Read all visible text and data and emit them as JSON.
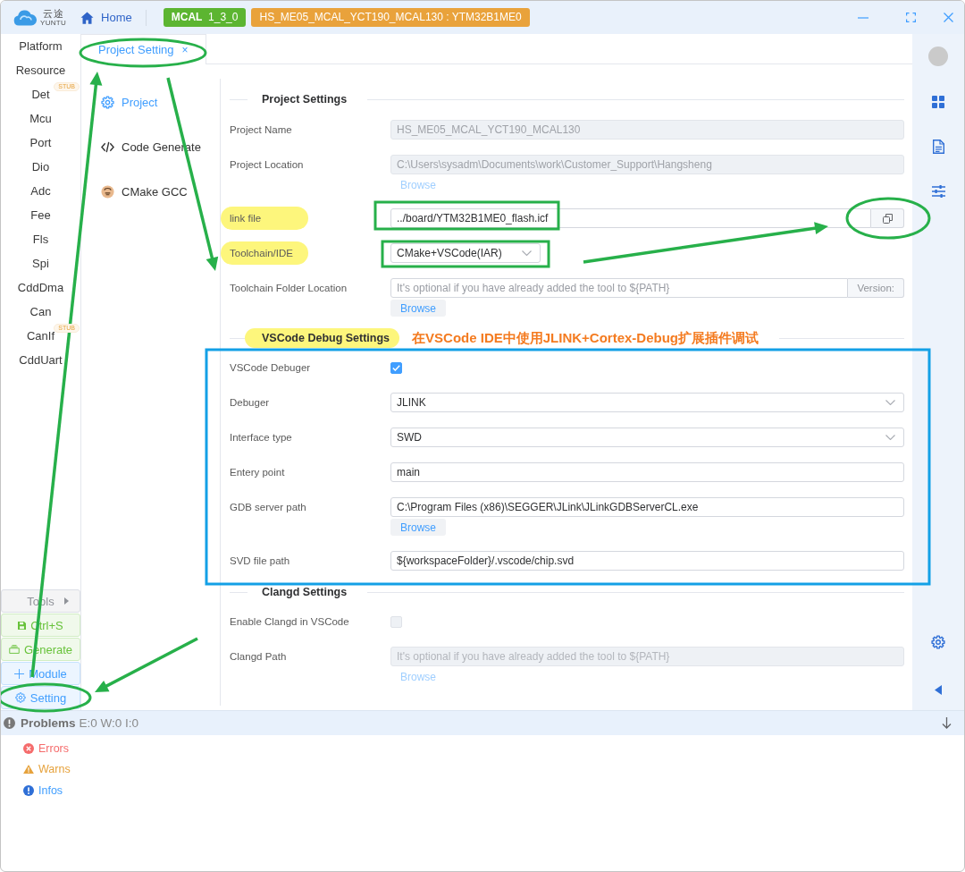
{
  "window": {
    "logo": {
      "name": "云途",
      "tagline": "YUNTU"
    },
    "home": "Home",
    "badges": [
      {
        "text": "**MCAL**  1_3_0",
        "color": "#5cb531"
      },
      {
        "text": "HS_ME05_MCAL_YCT190_MCAL130 : YTM32B1ME0",
        "color": "#e9a23b"
      }
    ]
  },
  "sidebar": {
    "items": [
      {
        "label": "Platform"
      },
      {
        "label": "Resource"
      },
      {
        "label": "Det",
        "badge": "STUB"
      },
      {
        "label": "Mcu"
      },
      {
        "label": "Port"
      },
      {
        "label": "Dio"
      },
      {
        "label": "Adc"
      },
      {
        "label": "Fee"
      },
      {
        "label": "Fls"
      },
      {
        "label": "Spi"
      },
      {
        "label": "CddDma"
      },
      {
        "label": "Can"
      },
      {
        "label": "CanIf",
        "badge": "STUB"
      },
      {
        "label": "CddUart"
      }
    ],
    "actions": [
      {
        "kind": "menu",
        "label": "Tools"
      },
      {
        "kind": "save",
        "label": "Ctrl+S"
      },
      {
        "kind": "generate",
        "label": "Generate"
      },
      {
        "kind": "add",
        "label": "Module"
      },
      {
        "kind": "setting",
        "label": "Setting"
      }
    ]
  },
  "tabs": [
    {
      "label": "Project Setting",
      "close": "×",
      "selected": true
    }
  ],
  "settings_nav": [
    {
      "kind": "gear",
      "label": "Project",
      "selected": true
    },
    {
      "kind": "code",
      "label": "Code Generate",
      "selected": false
    },
    {
      "kind": "gcc",
      "label": "CMake GCC",
      "selected": false
    }
  ],
  "form": {
    "sections": [
      {
        "title": "Project Settings",
        "highlighted": false,
        "fields": [
          {
            "kind": "input",
            "label": "Project Name",
            "value": "HS_ME05_MCAL_YCT190_MCAL130",
            "disabled": true,
            "highlighted": false
          },
          {
            "kind": "input",
            "label": "Project Location",
            "value": "C:\\Users\\sysadm\\Documents\\work\\Customer_Support\\Hangsheng",
            "disabled": true,
            "highlighted": false,
            "browse": {
              "label": "Browse",
              "disabled": true
            }
          },
          {
            "kind": "file",
            "label": "link file",
            "value": "../board/YTM32B1ME0_flash.icf",
            "disabled": false,
            "highlighted": true
          },
          {
            "kind": "inline_select",
            "label": "Toolchain/IDE",
            "value": "CMake+VSCode(IAR)",
            "disabled": false,
            "highlighted": true
          },
          {
            "kind": "input",
            "label": "Toolchain Folder Location",
            "placeholder": "It's optional if you have already added the tool to ${PATH}",
            "suffix": "Version:",
            "disabled": false,
            "highlighted": false,
            "browse": {
              "label": "Browse",
              "disabled": false
            }
          }
        ]
      },
      {
        "title": "VSCode Debug Settings",
        "highlighted": true,
        "note": "在VSCode IDE中使用JLINK+Cortex-Debug扩展插件调试",
        "fields": [
          {
            "kind": "checkbox",
            "label": "VSCode Debuger",
            "checked": true,
            "disabled": false,
            "highlighted": false
          },
          {
            "kind": "select",
            "label": "Debuger",
            "value": "JLINK",
            "disabled": false,
            "highlighted": false
          },
          {
            "kind": "select",
            "label": "Interface type",
            "value": "SWD",
            "disabled": false,
            "highlighted": false
          },
          {
            "kind": "input",
            "label": "Entery point",
            "value": "main",
            "disabled": false,
            "highlighted": false
          },
          {
            "kind": "input",
            "label": "GDB server path",
            "value": "C:\\Program Files (x86)\\SEGGER\\JLink\\JLinkGDBServerCL.exe",
            "disabled": false,
            "highlighted": false,
            "browse": {
              "label": "Browse",
              "disabled": false
            }
          },
          {
            "kind": "input",
            "label": "SVD file path",
            "value": "${workspaceFolder}/.vscode/chip.svd",
            "disabled": false,
            "highlighted": false
          }
        ]
      },
      {
        "title": "Clangd Settings",
        "highlighted": false,
        "fields": [
          {
            "kind": "checkbox",
            "label": "Enable Clangd in VSCode",
            "checked": false,
            "disabled": true,
            "highlighted": false
          },
          {
            "kind": "input",
            "label": "Clangd Path",
            "placeholder": "It's optional if you have already added the tool to ${PATH}",
            "disabled": true,
            "highlighted": false,
            "browse": {
              "label": "Browse",
              "disabled": true
            }
          }
        ]
      }
    ]
  },
  "problems": {
    "title": "Problems",
    "counts": "E:0 W:0 I:0",
    "items": [
      {
        "kind": "error",
        "label": "Errors"
      },
      {
        "kind": "warning",
        "label": "Warns"
      },
      {
        "kind": "info",
        "label": "Infos"
      }
    ]
  }
}
